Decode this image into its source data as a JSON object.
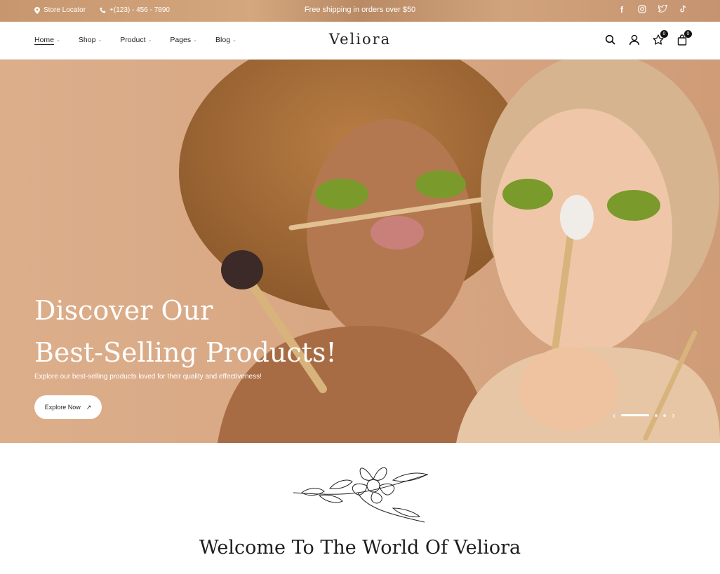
{
  "topbar": {
    "store_locator": "Store Locator",
    "phone": "+(123) - 456 - 7890",
    "shipping": "Free shipping in orders over $50",
    "social": [
      "f",
      "ig",
      "tw",
      "tt"
    ]
  },
  "header": {
    "logo": "Veliora",
    "nav": [
      {
        "label": "Home"
      },
      {
        "label": "Shop"
      },
      {
        "label": "Product"
      },
      {
        "label": "Pages"
      },
      {
        "label": "Blog"
      }
    ],
    "wishlist_count": "0",
    "cart_count": "0"
  },
  "hero": {
    "title_line1": "Discover Our",
    "title_line2": "Best-Selling Products!",
    "subtitle": "Explore our best-selling products loved for their quality and effectiveness!",
    "button_label": "Explore Now",
    "button_icon": "↗",
    "prev": "‹",
    "next": "›"
  },
  "welcome": {
    "title": "Welcome To The World Of Veliora"
  },
  "colors": {
    "hero_bg": "#d8a985",
    "topbar_bg": "#c7966e",
    "text_dark": "#1d1d1d"
  }
}
